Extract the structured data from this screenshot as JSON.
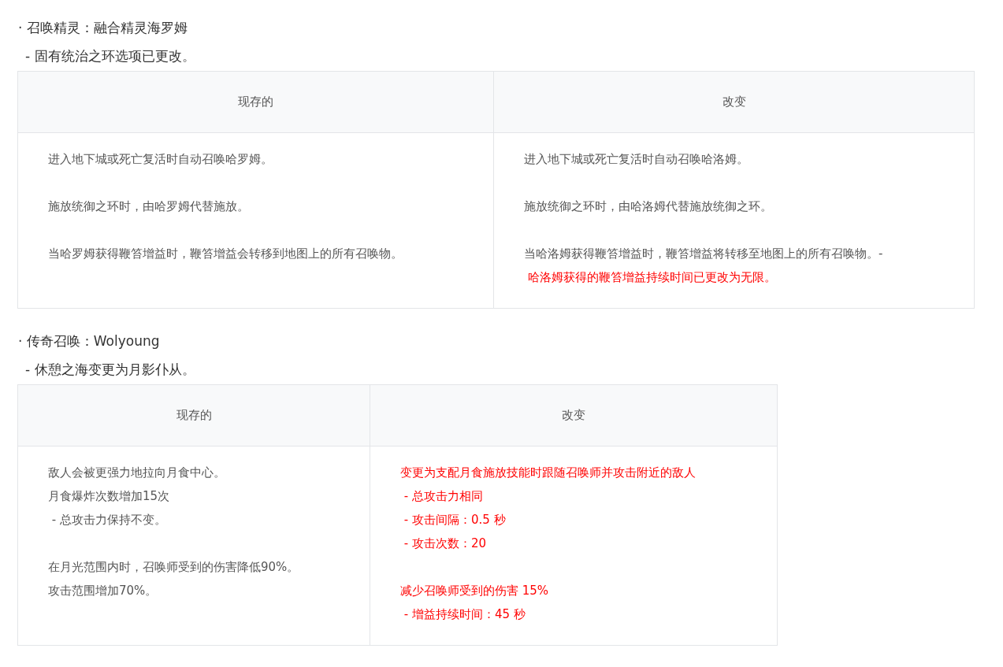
{
  "sections": [
    {
      "title": "· 召唤精灵：融合精灵海罗姆",
      "note": "- 固有统治之环选项已更改。",
      "table": {
        "headers": [
          "现存的",
          "改变"
        ],
        "cells": [
          [
            [
              {
                "text": "进入地下城或死亡复活时自动召唤哈罗姆。",
                "highlight": false
              }
            ],
            [
              {
                "text": "施放统御之环时，由哈罗姆代替施放。",
                "highlight": false
              }
            ],
            [
              {
                "text": "当哈罗姆获得鞭笞增益时，鞭笞增益会转移到地图上的所有召唤物。",
                "highlight": false
              }
            ]
          ],
          [
            [
              {
                "text": "进入地下城或死亡复活时自动召唤哈洛姆。",
                "highlight": false
              }
            ],
            [
              {
                "text": "施放统御之环时，由哈洛姆代替施放统御之环。",
                "highlight": false
              }
            ],
            [
              {
                "text": "当哈洛姆获得鞭笞增益时，鞭笞增益将转移至地图上的所有召唤物。-",
                "highlight": false
              },
              {
                "text": " 哈洛姆获得的鞭笞增益持续时间已更改为无限。",
                "highlight": true
              }
            ]
          ]
        ]
      }
    },
    {
      "title": "· 传奇召唤：Wolyoung",
      "note": "- 休憩之海变更为月影仆从。",
      "table": {
        "headers": [
          "现存的",
          "改变"
        ],
        "cells": [
          [
            [
              {
                "text": "敌人会被更强力地拉向月食中心。",
                "highlight": false
              },
              {
                "text": "月食爆炸次数增加15次",
                "highlight": false
              },
              {
                "text": " - 总攻击力保持不变。",
                "highlight": false
              }
            ],
            [
              {
                "text": "在月光范围内时，召唤师受到的伤害降低90%。",
                "highlight": false
              },
              {
                "text": "攻击范围增加70%。",
                "highlight": false
              }
            ]
          ],
          [
            [
              {
                "text": "变更为支配月食施放技能时跟随召唤师并攻击附近的敌人",
                "highlight": true
              },
              {
                "text": " - 总攻击力相同",
                "highlight": true
              },
              {
                "text": " - 攻击间隔：0.5 秒",
                "highlight": true
              },
              {
                "text": " - 攻击次数：20",
                "highlight": true
              }
            ],
            [
              {
                "text": "减少召唤师受到的伤害 15%",
                "highlight": true
              },
              {
                "text": " - 增益持续时间：45 秒",
                "highlight": true
              }
            ]
          ]
        ]
      }
    }
  ]
}
